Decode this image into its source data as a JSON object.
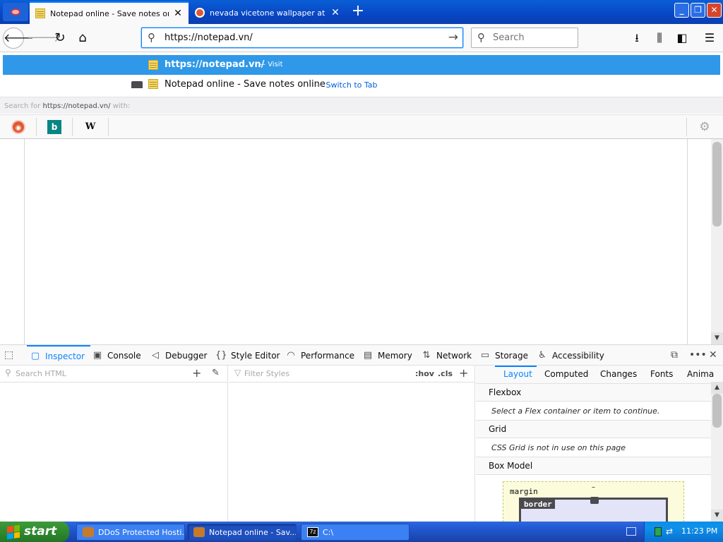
{
  "browser": {
    "tabs": [
      {
        "label": "Notepad online - Save notes online",
        "active": true
      },
      {
        "label": "nevada vicetone wallpaper at Duc",
        "active": false
      }
    ],
    "url": "https://notepad.vn/",
    "search_placeholder": "Search"
  },
  "autocomplete": {
    "visit_row": {
      "title": "https://notepad.vn/",
      "dash": "—",
      "action": "Visit"
    },
    "switch_row": {
      "title": "Notepad online - Save notes online",
      "dash": "—",
      "action": "Switch to Tab"
    },
    "search_for": {
      "prefix": "Search for",
      "url": "https://notepad.vn/",
      "suffix": "with:"
    },
    "engines": [
      "DuckDuckGo",
      "Bing",
      "Wikipedia"
    ]
  },
  "devtools": {
    "tabs": [
      "Inspector",
      "Console",
      "Debugger",
      "Style Editor",
      "Performance",
      "Memory",
      "Network",
      "Storage",
      "Accessibility"
    ],
    "selected_tab": "Inspector",
    "search_html_placeholder": "Search HTML",
    "filter_styles_placeholder": "Filter Styles",
    "hov_label": ":hov",
    "cls_label": ".cls",
    "side_tabs": [
      "Layout",
      "Computed",
      "Changes",
      "Fonts",
      "Anima"
    ],
    "selected_side_tab": "Layout",
    "sections": [
      {
        "title": "Flexbox",
        "message": "Select a Flex container or item to continue."
      },
      {
        "title": "Grid",
        "message": "CSS Grid is not in use on this page"
      },
      {
        "title": "Box Model"
      }
    ],
    "box_model": {
      "margin_label": "margin",
      "margin_value": "–",
      "border_label": "border"
    }
  },
  "taskbar": {
    "start_label": "start",
    "tasks": [
      "DDoS Protected Hosti...",
      "Notepad online - Sav...",
      "C:\\"
    ],
    "clock": "11:23 PM"
  }
}
